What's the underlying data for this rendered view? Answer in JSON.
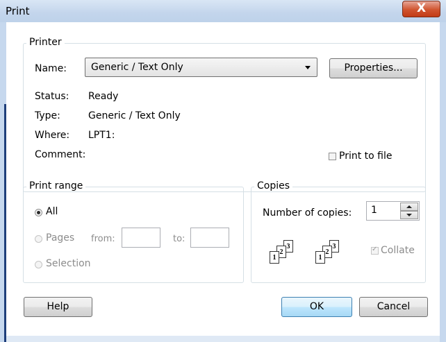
{
  "window": {
    "title": "Print",
    "close_label": "X"
  },
  "printer": {
    "legend": "Printer",
    "name_label": "Name:",
    "name_value": "Generic / Text Only",
    "properties_label": "Properties...",
    "status_label": "Status:",
    "status_value": "Ready",
    "type_label": "Type:",
    "type_value": "Generic / Text Only",
    "where_label": "Where:",
    "where_value": "LPT1:",
    "comment_label": "Comment:",
    "print_to_file_label": "Print to file",
    "print_to_file_checked": false
  },
  "print_range": {
    "legend": "Print range",
    "all_label": "All",
    "pages_label": "Pages",
    "from_label": "from:",
    "to_label": "to:",
    "from_value": "",
    "to_value": "",
    "selection_label": "Selection",
    "selected": "All"
  },
  "copies": {
    "legend": "Copies",
    "number_label": "Number of copies:",
    "number_value": "1",
    "collate_label": "Collate",
    "collate_checked": true,
    "collate_pages": [
      "1",
      "2",
      "3"
    ]
  },
  "buttons": {
    "help_label": "Help",
    "ok_label": "OK",
    "cancel_label": "Cancel"
  }
}
